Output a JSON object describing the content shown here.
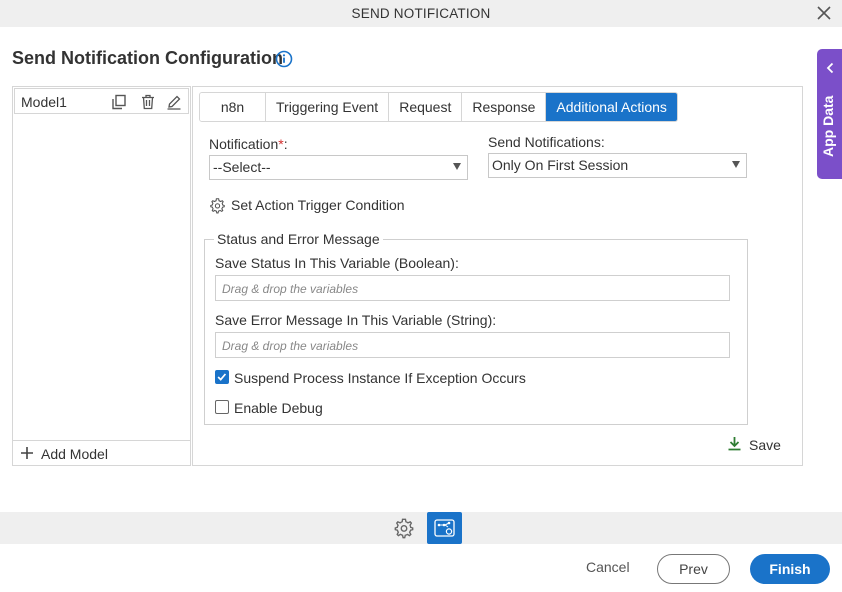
{
  "window": {
    "title": "SEND NOTIFICATION"
  },
  "page": {
    "title": "Send Notification Configuration"
  },
  "models": {
    "items": [
      {
        "label": "Model1"
      }
    ],
    "add_label": "Add Model"
  },
  "tabs": [
    {
      "label": "n8n"
    },
    {
      "label": "Triggering Event"
    },
    {
      "label": "Request"
    },
    {
      "label": "Response"
    },
    {
      "label": "Additional Actions",
      "active": true
    }
  ],
  "form": {
    "notification": {
      "label": "Notification",
      "required_mark": "*",
      "colon": ":",
      "value": "--Select--"
    },
    "send_notifications": {
      "label": "Send Notifications:",
      "value": "Only On First Session"
    },
    "trigger_condition_label": "Set Action Trigger Condition",
    "status_group": {
      "legend": "Status and Error Message",
      "status_var_label": "Save Status In This Variable (Boolean):",
      "status_var_placeholder": "Drag & drop the variables",
      "error_var_label": "Save Error Message In This Variable (String):",
      "error_var_placeholder": "Drag & drop the variables",
      "suspend_label": "Suspend Process Instance If Exception Occurs",
      "suspend_checked": true,
      "debug_label": "Enable Debug",
      "debug_checked": false
    },
    "save_label": "Save"
  },
  "side_panel": {
    "label": "App Data"
  },
  "footer": {
    "cancel_label": "Cancel",
    "prev_label": "Prev",
    "finish_label": "Finish"
  },
  "colors": {
    "accent": "#1a73c9",
    "side_tab": "#7b4fc9",
    "save_icon": "#2e7d32",
    "required": "#d32f2f"
  }
}
